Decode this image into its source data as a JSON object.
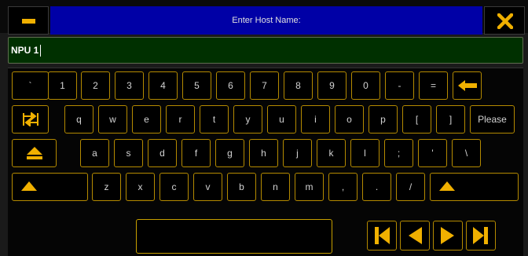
{
  "window": {
    "title": "Enter Host Name:"
  },
  "input": {
    "value": "NPU 1"
  },
  "keys": {
    "row1": [
      "`",
      "1",
      "2",
      "3",
      "4",
      "5",
      "6",
      "7",
      "8",
      "9",
      "0",
      "-",
      "="
    ],
    "row2": [
      "q",
      "w",
      "e",
      "r",
      "t",
      "y",
      "u",
      "i",
      "o",
      "p",
      "[",
      "]"
    ],
    "row2_extra": "Please",
    "row3": [
      "a",
      "s",
      "d",
      "f",
      "g",
      "h",
      "j",
      "k",
      "l",
      ";",
      "'",
      "\\"
    ],
    "row4": [
      "z",
      "x",
      "c",
      "v",
      "b",
      "n",
      "m",
      ",",
      ".",
      "/"
    ]
  },
  "icons": {
    "minimize": "minus-icon",
    "close": "close-x-icon",
    "backspace": "arrow-left-icon",
    "tab": "tab-icon",
    "caps": "eject-caps-icon",
    "shift": "shift-up-icon",
    "nav": [
      "skip-start-icon",
      "arrow-left-icon",
      "arrow-right-icon",
      "skip-end-icon"
    ]
  },
  "colors": {
    "accent": "#f0b000",
    "title_bg": "#0000a6",
    "input_bg": "#003000",
    "key_border": "#b48a00"
  }
}
